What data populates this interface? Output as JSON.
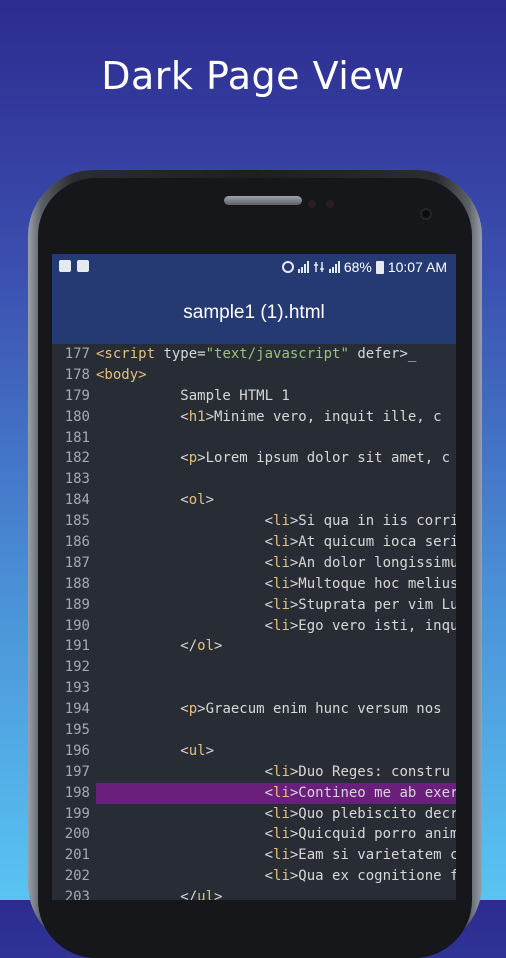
{
  "headline": "Dark Page View",
  "status_bar": {
    "battery": "68%",
    "time": "10:07 AM"
  },
  "app_bar": {
    "title": "sample1 (1).html"
  },
  "colors": {
    "bar": "#253a72",
    "editor_bg": "#282c34",
    "tag": "#e5c07b",
    "string": "#98c379",
    "highlight": "#6b1f7c"
  },
  "lines": [
    {
      "n": "177",
      "parts": [
        {
          "t": "<script",
          "c": "tag"
        },
        {
          "t": " type=",
          "c": "plain"
        },
        {
          "t": "\"text/javascript\"",
          "c": "str"
        },
        {
          "t": " defer>_",
          "c": "plain"
        }
      ]
    },
    {
      "n": "178",
      "parts": [
        {
          "t": "<body>",
          "c": "tag"
        }
      ]
    },
    {
      "n": "179",
      "parts": [
        {
          "t": "          Sample HTML 1",
          "c": "plain"
        }
      ]
    },
    {
      "n": "180",
      "parts": [
        {
          "t": "          <",
          "c": "plain"
        },
        {
          "t": "h1",
          "c": "tag"
        },
        {
          "t": ">Minime vero, inquit ille, c",
          "c": "plain"
        }
      ]
    },
    {
      "n": "181",
      "parts": []
    },
    {
      "n": "182",
      "parts": [
        {
          "t": "          <",
          "c": "plain"
        },
        {
          "t": "p",
          "c": "tag"
        },
        {
          "t": ">Lorem ipsum dolor sit amet, c",
          "c": "plain"
        }
      ]
    },
    {
      "n": "183",
      "parts": []
    },
    {
      "n": "184",
      "parts": [
        {
          "t": "          <",
          "c": "plain"
        },
        {
          "t": "ol",
          "c": "tag"
        },
        {
          "t": ">",
          "c": "plain"
        }
      ]
    },
    {
      "n": "185",
      "parts": [
        {
          "t": "                    <",
          "c": "plain"
        },
        {
          "t": "li",
          "c": "tag"
        },
        {
          "t": ">Si qua in iis corri",
          "c": "plain"
        }
      ]
    },
    {
      "n": "186",
      "parts": [
        {
          "t": "                    <",
          "c": "plain"
        },
        {
          "t": "li",
          "c": "tag"
        },
        {
          "t": ">At quicum ioca seri",
          "c": "plain"
        }
      ]
    },
    {
      "n": "187",
      "parts": [
        {
          "t": "                    <",
          "c": "plain"
        },
        {
          "t": "li",
          "c": "tag"
        },
        {
          "t": ">An dolor longissimu",
          "c": "plain"
        }
      ]
    },
    {
      "n": "188",
      "parts": [
        {
          "t": "                    <",
          "c": "plain"
        },
        {
          "t": "li",
          "c": "tag"
        },
        {
          "t": ">Multoque hoc melius",
          "c": "plain"
        }
      ]
    },
    {
      "n": "189",
      "parts": [
        {
          "t": "                    <",
          "c": "plain"
        },
        {
          "t": "li",
          "c": "tag"
        },
        {
          "t": ">Stuprata per vim Lu",
          "c": "plain"
        }
      ]
    },
    {
      "n": "190",
      "parts": [
        {
          "t": "                    <",
          "c": "plain"
        },
        {
          "t": "li",
          "c": "tag"
        },
        {
          "t": ">Ego vero isti, inqu",
          "c": "plain"
        }
      ]
    },
    {
      "n": "191",
      "parts": [
        {
          "t": "          </",
          "c": "plain"
        },
        {
          "t": "ol",
          "c": "tag"
        },
        {
          "t": ">",
          "c": "plain"
        }
      ]
    },
    {
      "n": "192",
      "parts": []
    },
    {
      "n": "193",
      "parts": []
    },
    {
      "n": "194",
      "parts": [
        {
          "t": "          <",
          "c": "plain"
        },
        {
          "t": "p",
          "c": "tag"
        },
        {
          "t": ">Graecum enim hunc versum nos",
          "c": "plain"
        }
      ]
    },
    {
      "n": "195",
      "parts": []
    },
    {
      "n": "196",
      "parts": [
        {
          "t": "          <",
          "c": "plain"
        },
        {
          "t": "ul",
          "c": "tag"
        },
        {
          "t": ">",
          "c": "plain"
        }
      ]
    },
    {
      "n": "197",
      "parts": [
        {
          "t": "                    <",
          "c": "plain"
        },
        {
          "t": "li",
          "c": "tag"
        },
        {
          "t": ">Duo Reges: constru",
          "c": "plain"
        }
      ]
    },
    {
      "n": "198",
      "hl": true,
      "parts": [
        {
          "t": "                    <",
          "c": "plain"
        },
        {
          "t": "li",
          "c": "tag"
        },
        {
          "t": ">Contineo me ab exer",
          "c": "plain"
        }
      ]
    },
    {
      "n": "199",
      "parts": [
        {
          "t": "                    <",
          "c": "plain"
        },
        {
          "t": "li",
          "c": "tag"
        },
        {
          "t": ">Quo plebiscito decr",
          "c": "plain"
        }
      ]
    },
    {
      "n": "200",
      "parts": [
        {
          "t": "                    <",
          "c": "plain"
        },
        {
          "t": "li",
          "c": "tag"
        },
        {
          "t": ">Quicquid porro anim",
          "c": "plain"
        }
      ]
    },
    {
      "n": "201",
      "parts": [
        {
          "t": "                    <",
          "c": "plain"
        },
        {
          "t": "li",
          "c": "tag"
        },
        {
          "t": ">Eam si varietatem c",
          "c": "plain"
        }
      ]
    },
    {
      "n": "202",
      "parts": [
        {
          "t": "                    <",
          "c": "plain"
        },
        {
          "t": "li",
          "c": "tag"
        },
        {
          "t": ">Qua ex cognitione f",
          "c": "plain"
        }
      ]
    },
    {
      "n": "203",
      "parts": [
        {
          "t": "          </",
          "c": "plain"
        },
        {
          "t": "ul",
          "c": "tag"
        },
        {
          "t": ">",
          "c": "plain"
        }
      ]
    }
  ]
}
